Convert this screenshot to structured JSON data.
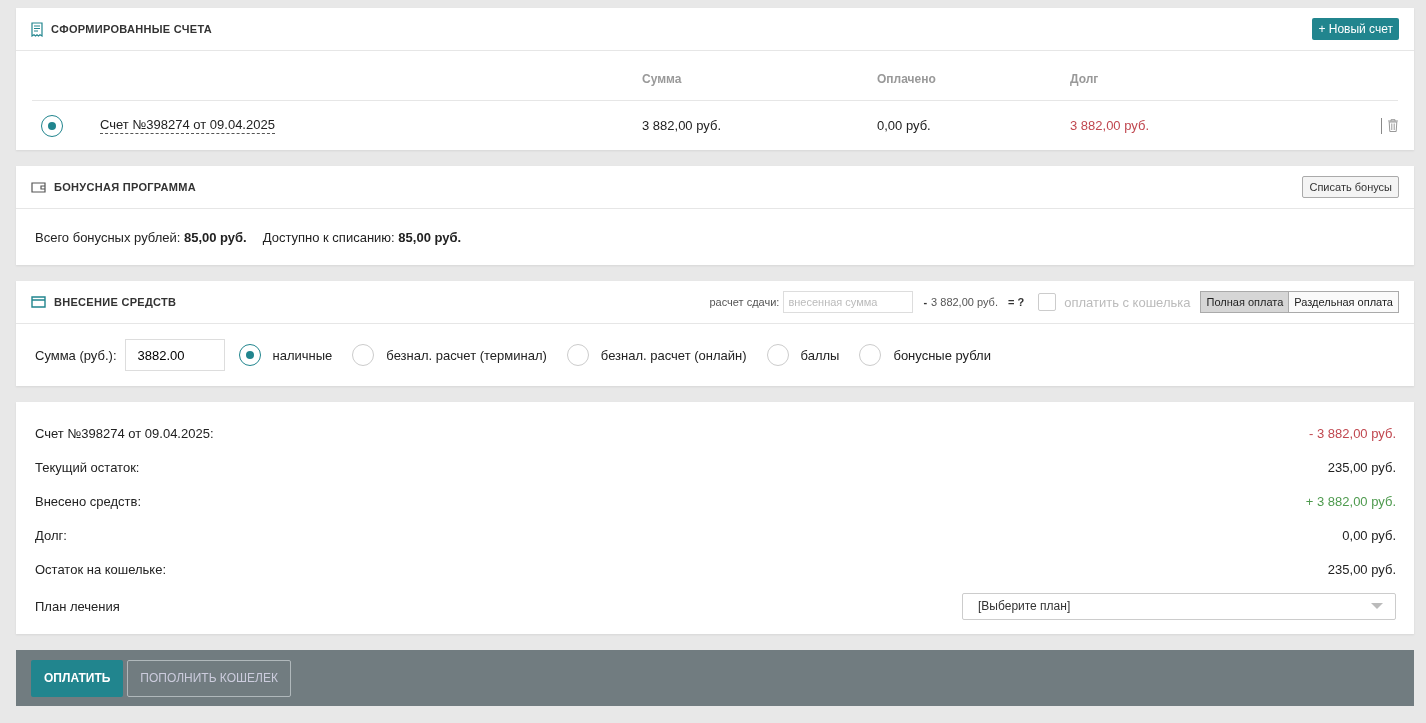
{
  "invoices": {
    "title": "СФОРМИРОВАННЫЕ СЧЕТА",
    "new_button": "+ Новый счет",
    "columns": [
      "Сумма",
      "Оплачено",
      "Долг"
    ],
    "rows": [
      {
        "selected": true,
        "name": "Счет №398274 от 09.04.2025",
        "sum": "3 882,00 руб.",
        "paid": "0,00 руб.",
        "debt": "3 882,00 руб."
      }
    ]
  },
  "bonus": {
    "title": "БОНУСНАЯ ПРОГРАММА",
    "button": "Списать бонусы",
    "lines": [
      "Всего бонусных рублей: **85,00 руб.**",
      "Доступно к списанию: **85,00 руб.**"
    ]
  },
  "deposit": {
    "title": "ВНЕСЕНИЕ СРЕДСТВ",
    "change_label": "расчет сдачи:",
    "change_placeholder": "внесенная сумма",
    "minus": "-",
    "change_amount": "3 882,00 руб.",
    "equals": "= ?",
    "wallet": {
      "label": "оплатить с кошелька",
      "checked": false,
      "disabled": true
    },
    "modes": [
      {
        "label": "Полная оплата",
        "selected": true
      },
      {
        "label": "Раздельная оплата",
        "selected": false
      }
    ],
    "amount_label": "Сумма (руб.):",
    "amount_value": "3882.00",
    "methods": [
      {
        "label": "наличные",
        "selected": true
      },
      {
        "label": "безнал. расчет (терминал)",
        "selected": false
      },
      {
        "label": "безнал. расчет (онлайн)",
        "selected": false
      },
      {
        "label": "баллы",
        "selected": false
      },
      {
        "label": "бонусные рубли",
        "selected": false
      }
    ]
  },
  "summary": {
    "rows": [
      {
        "label": "Счет №398274 от 09.04.2025:",
        "value": "- 3 882,00 руб.",
        "color": "#c0474f"
      },
      {
        "label": "Текущий остаток:",
        "value": "235,00 руб.",
        "color": "#222222"
      },
      {
        "label": "Внесено средств:",
        "value": "+ 3 882,00 руб.",
        "color": "#4e9a4e"
      },
      {
        "label": "Долг:",
        "value": "0,00 руб.",
        "color": "#222222"
      },
      {
        "label": "Остаток на кошельке:",
        "value": "235,00 руб.",
        "color": "#222222"
      }
    ],
    "plan_label": "План лечения",
    "plan_value": "[Выберите план]"
  },
  "footer": {
    "pay": "ОПЛАТИТЬ",
    "topup": "ПОПОЛНИТЬ КОШЕЛЕК"
  }
}
